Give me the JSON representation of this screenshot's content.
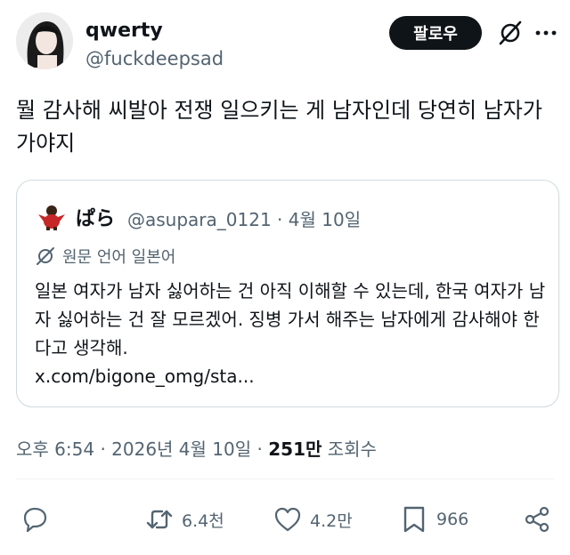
{
  "author": {
    "name": "qwerty",
    "handle": "@fuckdeepsad"
  },
  "header": {
    "follow_label": "팔로우"
  },
  "tweet": {
    "text": "뭘 감사해 씨발아 전쟁 일으키는 게 남자인데 당연히 남자가 가야지"
  },
  "quote": {
    "name": "ぱら",
    "handle": "@asupara_0121",
    "date": "4월 10일",
    "translate_label": "원문 언어 일본어",
    "text": "일본 여자가 남자 싫어하는 건 아직 이해할 수 있는데, 한국 여자가 남자 싫어하는 건 잘 모르겠어. 징병 가서 해주는 남자에게 감사해야 한다고 생각해.",
    "link": "x.com/bigone_omg/sta..."
  },
  "meta": {
    "time": "오후 6:54",
    "date": "2026년 4월 10일",
    "views_count": "251만",
    "views_label": "조회수"
  },
  "actions": {
    "retweets": "6.4천",
    "likes": "4.2만",
    "bookmarks": "966"
  },
  "colors": {
    "text": "#0f1419",
    "muted": "#536471",
    "border": "#cfd9de"
  }
}
